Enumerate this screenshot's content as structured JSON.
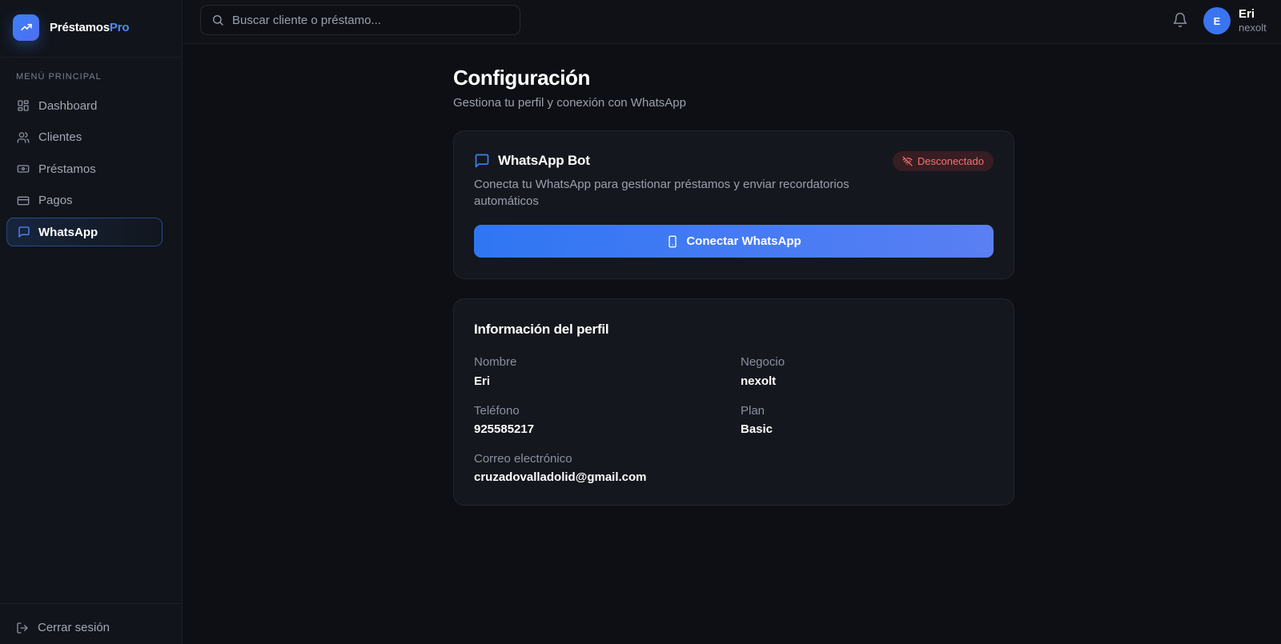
{
  "brand": {
    "name_main": "Préstamos",
    "name_accent": "Pro"
  },
  "sidebar": {
    "menu_title": "MENÚ PRINCIPAL",
    "items": [
      {
        "label": "Dashboard",
        "icon": "grid-icon"
      },
      {
        "label": "Clientes",
        "icon": "users-icon"
      },
      {
        "label": "Préstamos",
        "icon": "banknote-icon"
      },
      {
        "label": "Pagos",
        "icon": "credit-card-icon"
      },
      {
        "label": "WhatsApp",
        "icon": "message-square-icon",
        "active": true
      }
    ],
    "logout_label": "Cerrar sesión"
  },
  "topbar": {
    "search_placeholder": "Buscar cliente o préstamo...",
    "user": {
      "initial": "E",
      "name": "Eri",
      "business": "nexolt"
    }
  },
  "page": {
    "title": "Configuración",
    "subtitle": "Gestiona tu perfil y conexión con WhatsApp"
  },
  "whatsapp_card": {
    "title": "WhatsApp Bot",
    "status": "Desconectado",
    "description": "Conecta tu WhatsApp para gestionar préstamos y enviar recordatorios automáticos",
    "button_label": "Conectar WhatsApp"
  },
  "profile_card": {
    "title": "Información del perfil",
    "fields": {
      "name_label": "Nombre",
      "name_value": "Eri",
      "business_label": "Negocio",
      "business_value": "nexolt",
      "phone_label": "Teléfono",
      "phone_value": "925585217",
      "plan_label": "Plan",
      "plan_value": "Basic",
      "email_label": "Correo electrónico",
      "email_value": "cruzadovalladolid@gmail.com"
    }
  },
  "colors": {
    "accent": "#3b82f6",
    "background": "#0d0f14",
    "status_disconnected": "#f87171"
  }
}
